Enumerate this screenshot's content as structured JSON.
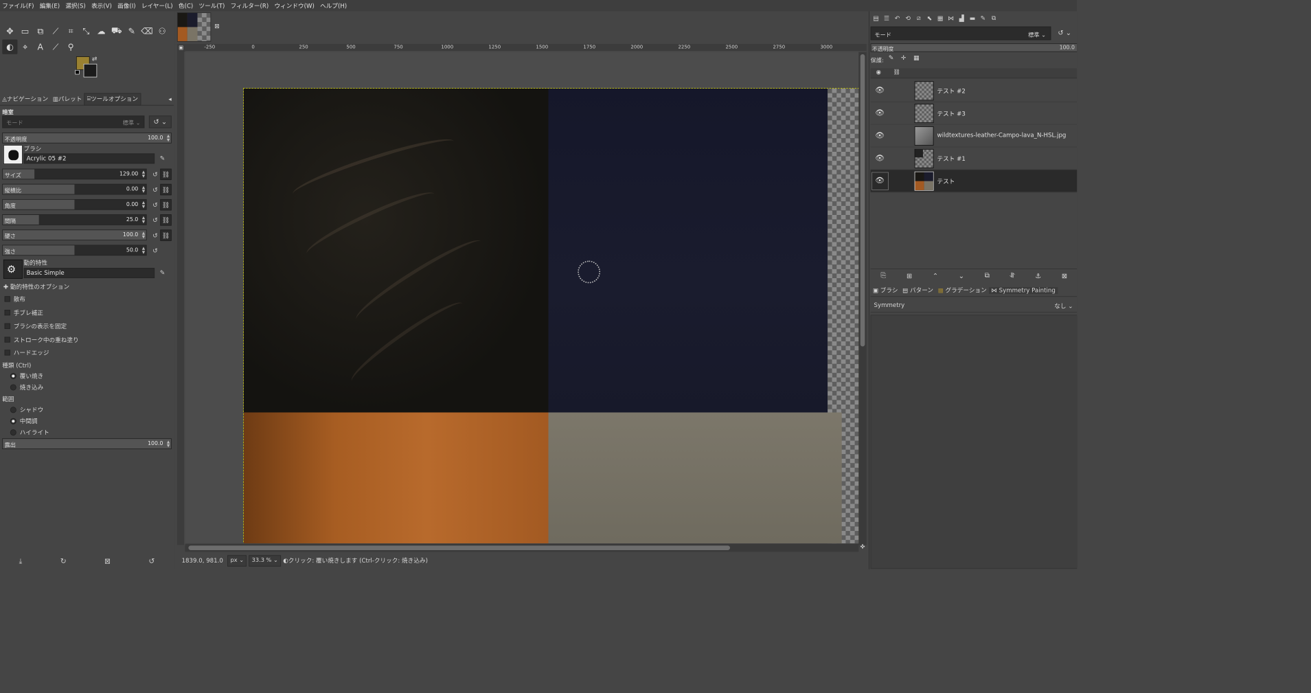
{
  "menubar": [
    "ファイル(F)",
    "編集(E)",
    "選択(S)",
    "表示(V)",
    "画像(I)",
    "レイヤー(L)",
    "色(C)",
    "ツール(T)",
    "フィルター(R)",
    "ウィンドウ(W)",
    "ヘルプ(H)"
  ],
  "colors": {
    "foreground": "#9a8131",
    "background": "#1b1b1b",
    "selection_border": "#c9c90a"
  },
  "toolbox": {
    "tabs": [
      "ナビゲーション",
      "パレット",
      "ツールオプション"
    ],
    "title": "暗室",
    "mode": {
      "label": "モード",
      "value": "標準"
    },
    "opacity": {
      "label": "不透明度",
      "value": "100.0",
      "fill": 1.0
    },
    "brush": {
      "label": "ブラシ",
      "name": "Acrylic 05 #2"
    },
    "size": {
      "label": "サイズ",
      "value": "129.00",
      "fill": 0.22
    },
    "aspect": {
      "label": "縦横比",
      "value": "0.00",
      "fill": 0.5
    },
    "angle": {
      "label": "角度",
      "value": "0.00",
      "fill": 0.5
    },
    "spacing": {
      "label": "間隔",
      "value": "25.0",
      "fill": 0.25
    },
    "hardness": {
      "label": "硬さ",
      "value": "100.0",
      "fill": 1.0
    },
    "force": {
      "label": "強さ",
      "value": "50.0",
      "fill": 0.5
    },
    "dynamics": {
      "label": "動的特性",
      "name": "Basic Simple"
    },
    "dynamics_options": "動的特性のオプション",
    "checks": [
      "散布",
      "手ブレ補正",
      "ブラシの表示を固定",
      "ストローク中の重ね塗り",
      "ハードエッジ"
    ],
    "type": {
      "label": "種類 (Ctrl)",
      "options": [
        "覆い焼き",
        "焼き込み"
      ],
      "selected": 0
    },
    "range": {
      "label": "範囲",
      "options": [
        "シャドウ",
        "中間調",
        "ハイライト"
      ],
      "selected": 1
    },
    "exposure": {
      "label": "露出",
      "value": "100.0",
      "fill": 1.0
    }
  },
  "ruler": {
    "top": [
      "-250",
      "0",
      "250",
      "500",
      "750",
      "1000",
      "1250",
      "1500",
      "1750",
      "2000",
      "2250",
      "2500",
      "2750",
      "3000"
    ]
  },
  "statusbar": {
    "coords": "1839.0, 981.0",
    "unit": "px",
    "zoom": "33.3 %",
    "message": "クリック: 覆い焼きします (Ctrl-クリック: 焼き込み)"
  },
  "layers_panel": {
    "mode": {
      "label": "モード",
      "value": "標準"
    },
    "opacity": {
      "label": "不透明度",
      "value": "100.0"
    },
    "lock_label": "保護:",
    "layers": [
      {
        "name": "テスト #2",
        "thumb": "checker"
      },
      {
        "name": "テスト #3",
        "thumb": "checker"
      },
      {
        "name": "wildtextures-leather-Campo-lava_N-HSL.jpg",
        "thumb": "gray"
      },
      {
        "name": "テスト #1",
        "thumb": "checker-dark"
      },
      {
        "name": "テスト",
        "thumb": "quad"
      }
    ],
    "selected_index": 4
  },
  "lower_dock": {
    "tabs": [
      "ブラシ",
      "パターン",
      "グラデーション",
      "Symmetry Painting"
    ],
    "symmetry": {
      "label": "Symmetry",
      "value": "なし"
    }
  }
}
